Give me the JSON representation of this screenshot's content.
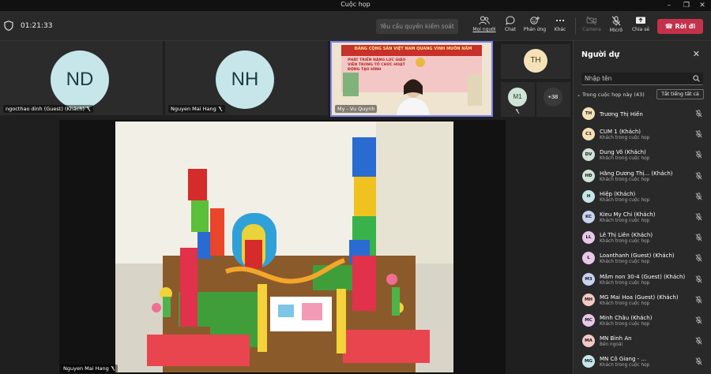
{
  "window": {
    "title": "Cuộc họp"
  },
  "toolbar": {
    "timer": "01:21:33",
    "request_control": "Yêu cầu quyền kiểm soát",
    "people": "Mọi người",
    "chat": "Chat",
    "react": "Phản ứng",
    "more": "Khác",
    "camera": "Camera",
    "mic": "Micrô",
    "share": "Chia sẻ",
    "leave": "Rời đi"
  },
  "stage": {
    "tiles": [
      {
        "initials": "ND",
        "name": "ngocthao dinh (Guest) (Khách)",
        "color": "#c6e6ea"
      },
      {
        "initials": "NH",
        "name": "Nguyen Mai Hang",
        "color": "#c6e6ea"
      },
      {
        "name": "My - Vu Quynh",
        "banner_top": "ĐẢNG CỘNG SẢN VIỆT NAM QUANG VINH MUÔN NĂM",
        "banner_main": "PHÁT TRIỂN NĂNG LỰC GIÁO VIÊN TRONG TỔ CHỨC HOẠT ĐỘNG TẠO HÌNH"
      },
      {
        "initials": "TH",
        "color": "#f5e1b8"
      },
      {
        "initials": "M1",
        "color": "#cfe3d6"
      },
      {
        "overflow": "+38"
      }
    ],
    "share_presenter": "Nguyen Mai Hang"
  },
  "panel": {
    "title": "Người dự",
    "search_placeholder": "Nhập tên",
    "group_label": "Trong cuộc họp này (43)",
    "mute_all": "Tắt tiếng tất cả",
    "participants": [
      {
        "initials": "TH",
        "name": "Trương Thị Hiền",
        "sub": "",
        "color": "#f5e1b8"
      },
      {
        "initials": "C1",
        "name": "CUM 1 (Khách)",
        "sub": "Khách trong cuộc họp",
        "color": "#f5e1b8"
      },
      {
        "initials": "DV",
        "name": "Dung Võ (Khách)",
        "sub": "Khách trong cuộc họp",
        "color": "#cfe3d6"
      },
      {
        "initials": "HĐ",
        "name": "Hằng Dương Thị... (Khách)",
        "sub": "Khách trong cuộc họp",
        "color": "#cfe3d6"
      },
      {
        "initials": "H",
        "name": "Hiệp (Khách)",
        "sub": "Khách trong cuộc họp",
        "color": "#c6e6ea"
      },
      {
        "initials": "KC",
        "name": "Kieu My Chi (Khách)",
        "sub": "Khách trong cuộc họp",
        "color": "#c8d3f0"
      },
      {
        "initials": "LL",
        "name": "Lê Thị Liên (Khách)",
        "sub": "Khách trong cuộc họp",
        "color": "#e7c8ea"
      },
      {
        "initials": "L",
        "name": "Loanthanh (Guest) (Khách)",
        "sub": "Khách trong cuộc họp",
        "color": "#e7c8ea"
      },
      {
        "initials": "M3",
        "name": "Mầm non 30-4 (Guest) (Khách)",
        "sub": "Khách trong cuộc họp",
        "color": "#c8d3f0"
      },
      {
        "initials": "MH",
        "name": "MG Mai Hoa (Guest) (Khách)",
        "sub": "Khách trong cuộc họp",
        "color": "#f3c9c3"
      },
      {
        "initials": "MC",
        "name": "Minh Châu (Khách)",
        "sub": "Khách trong cuộc họp",
        "color": "#e7c8ea"
      },
      {
        "initials": "MA",
        "name": "MN Bình An",
        "sub": "Bên ngoài",
        "color": "#f3c9c3"
      },
      {
        "initials": "MG",
        "name": "MN Cô Giang - ...",
        "sub": "Khách trong cuộc họp",
        "color": "#c6e6ea"
      }
    ]
  }
}
